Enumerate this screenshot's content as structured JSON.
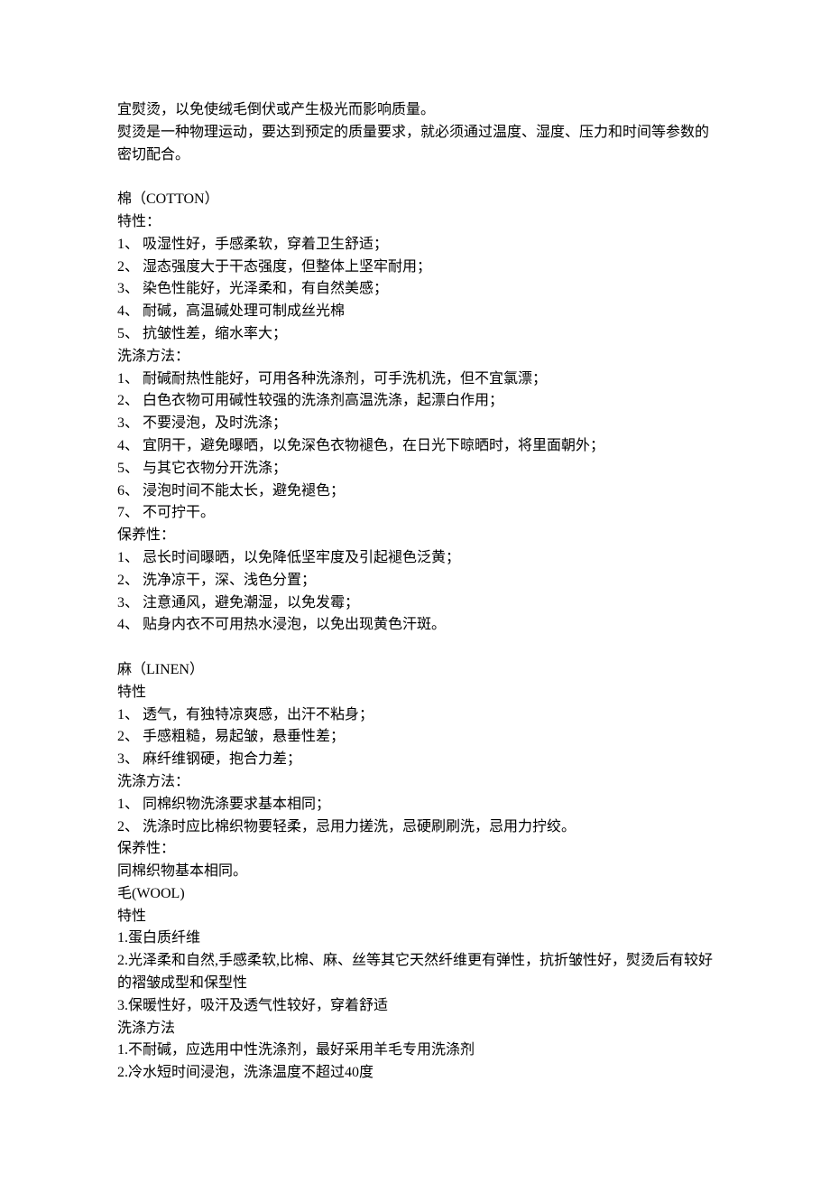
{
  "lines": [
    "宜熨烫，以免使绒毛倒伏或产生极光而影响质量。",
    "熨烫是一种物理运动，要达到预定的质量要求，就必须通过温度、湿度、压力和时间等参数的密切配合。",
    "",
    "棉（COTTON）",
    "特性：",
    "1、 吸湿性好，手感柔软，穿着卫生舒适；",
    "2、 湿态强度大于干态强度，但整体上坚牢耐用；",
    "3、 染色性能好，光泽柔和，有自然美感；",
    "4、 耐碱，高温碱处理可制成丝光棉",
    "5、 抗皱性差，缩水率大；",
    "洗涤方法：",
    "1、 耐碱耐热性能好，可用各种洗涤剂，可手洗机洗，但不宜氯漂；",
    "2、 白色衣物可用碱性较强的洗涤剂高温洗涤，起漂白作用；",
    "3、 不要浸泡，及时洗涤；",
    "4、 宜阴干，避免曝晒，以免深色衣物褪色，在日光下晾晒时，将里面朝外；",
    "5、 与其它衣物分开洗涤；",
    "6、 浸泡时间不能太长，避免褪色；",
    "7、 不可拧干。",
    "保养性：",
    "1、 忌长时间曝晒，以免降低坚牢度及引起褪色泛黄；",
    "2、 洗净凉干，深、浅色分置；",
    "3、 注意通风，避免潮湿，以免发霉；",
    "4、 贴身内衣不可用热水浸泡，以免出现黄色汗斑。",
    "",
    "麻（LINEN）",
    "特性",
    "1、 透气，有独特凉爽感，出汗不粘身；",
    "2、 手感粗糙，易起皱，悬垂性差；",
    "3、 麻纤维钢硬，抱合力差；",
    "洗涤方法：",
    "1、 同棉织物洗涤要求基本相同；",
    "2、 洗涤时应比棉织物要轻柔，忌用力搓洗，忌硬刷刷洗，忌用力拧绞。",
    "保养性：",
    "同棉织物基本相同。",
    "毛(WOOL)",
    "特性",
    "1.蛋白质纤维",
    "2.光泽柔和自然,手感柔软,比棉、麻、丝等其它天然纤维更有弹性，抗折皱性好，熨烫后有较好的褶皱成型和保型性",
    "3.保暖性好，吸汗及透气性较好，穿着舒适",
    "洗涤方法",
    "1.不耐碱，应选用中性洗涤剂，最好采用羊毛专用洗涤剂",
    "2.冷水短时间浸泡，洗涤温度不超过40度"
  ]
}
